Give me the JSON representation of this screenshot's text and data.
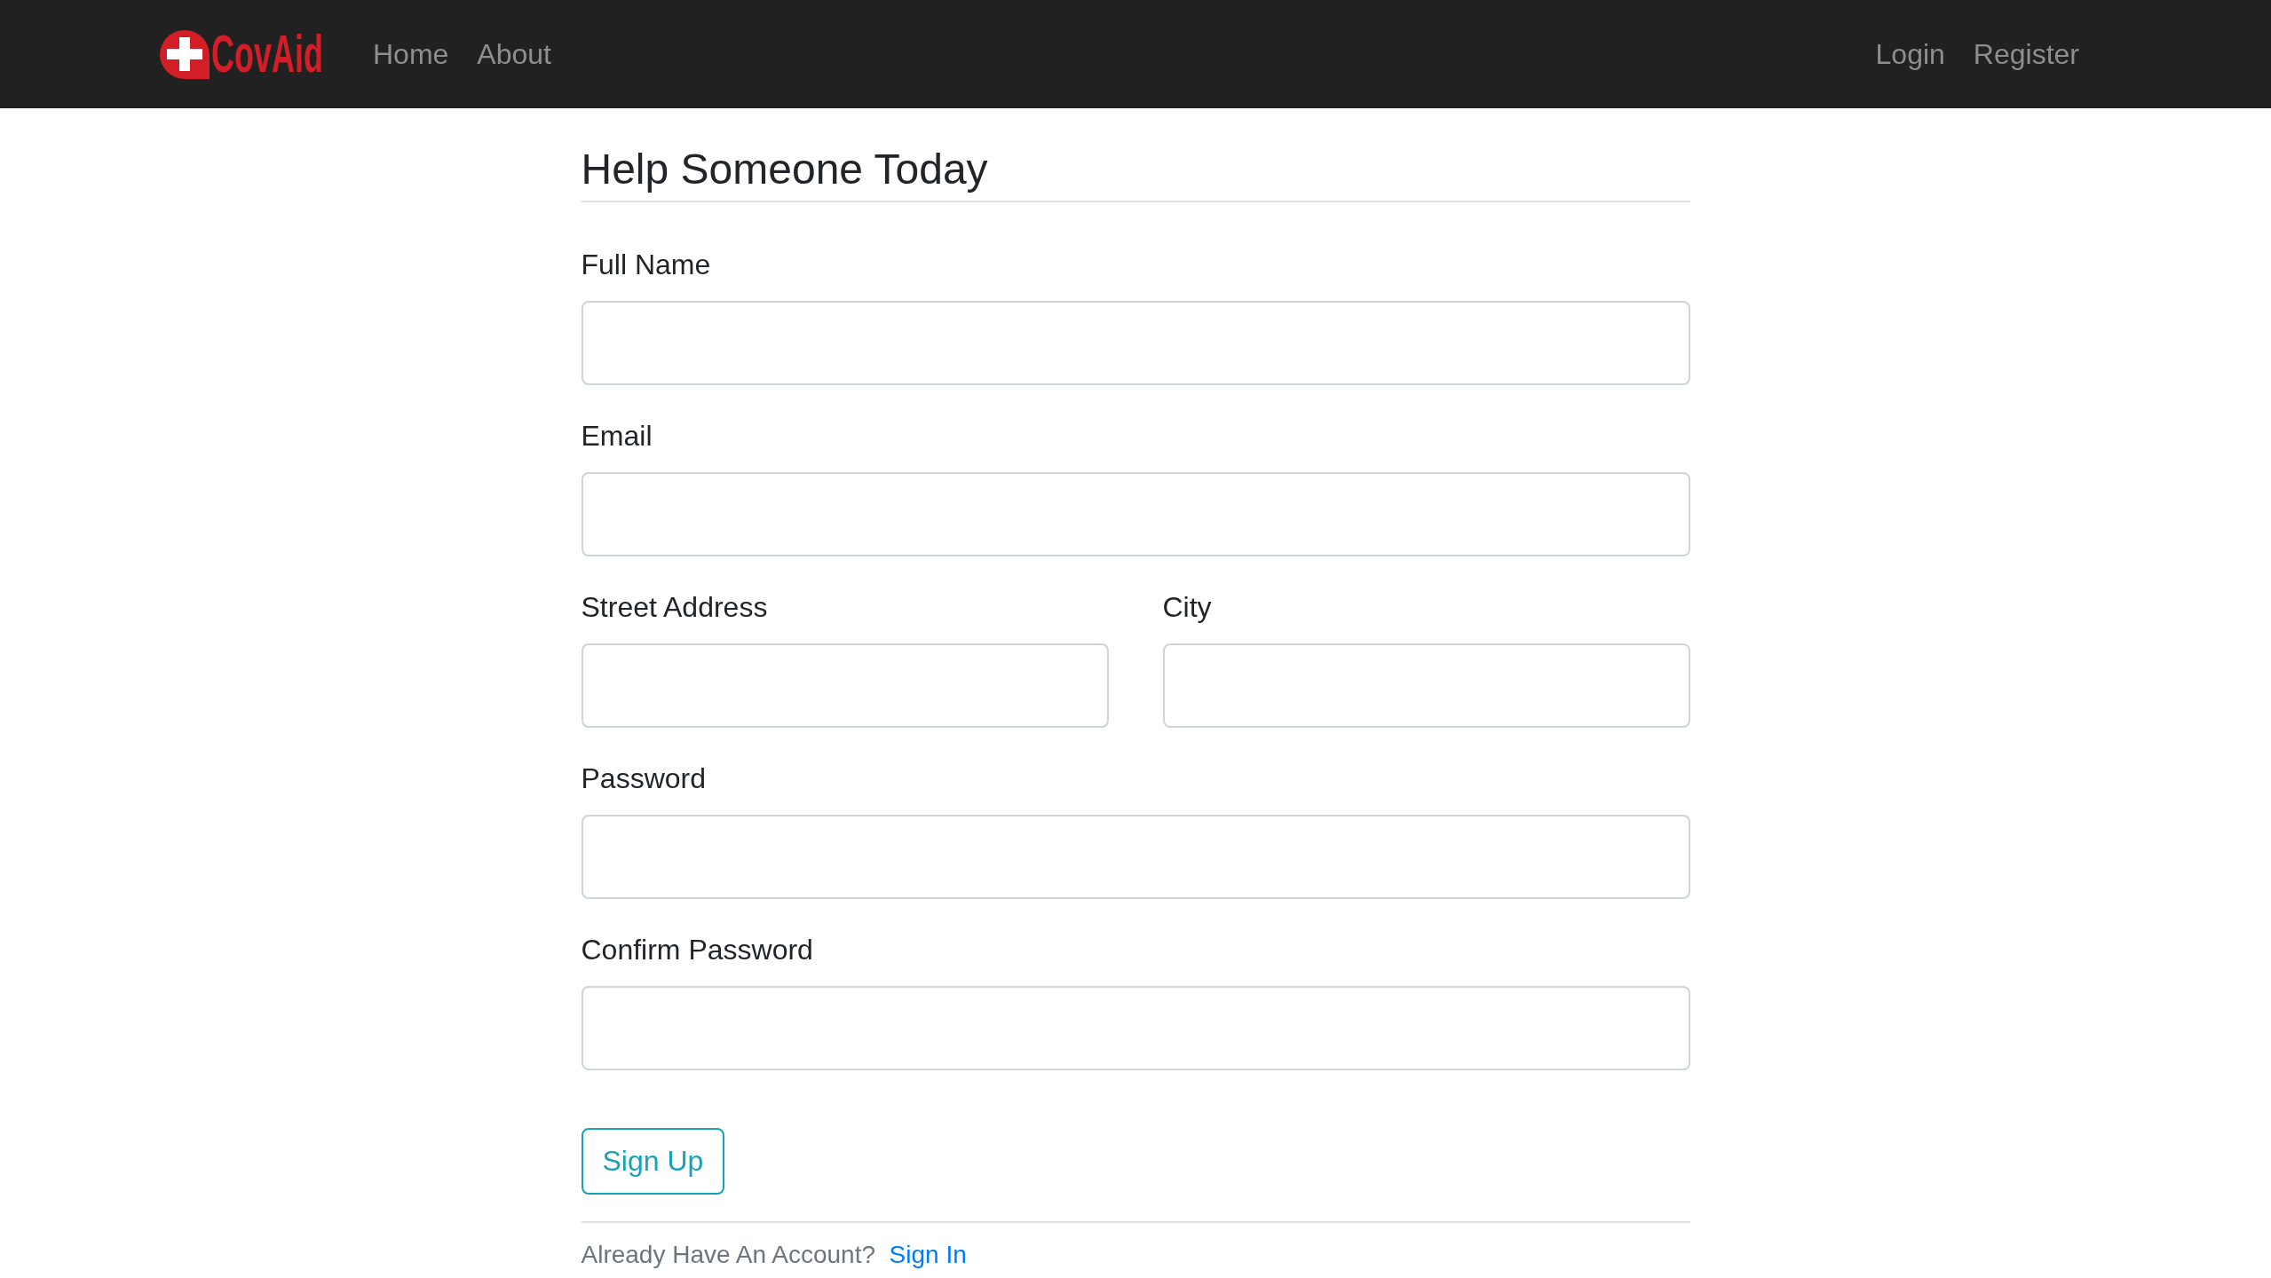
{
  "navbar": {
    "brand": "CovAid",
    "links": [
      {
        "label": "Home"
      },
      {
        "label": "About"
      }
    ],
    "account_links": [
      {
        "label": "Login"
      },
      {
        "label": "Register"
      }
    ]
  },
  "form": {
    "title": "Help Someone Today",
    "rows": [
      {
        "fields": [
          {
            "label": "Full Name"
          }
        ]
      },
      {
        "fields": [
          {
            "label": "Email"
          }
        ]
      },
      {
        "fields": [
          {
            "label": "Street Address"
          },
          {
            "label": "City"
          }
        ]
      },
      {
        "fields": [
          {
            "label": "Password"
          }
        ]
      },
      {
        "fields": [
          {
            "label": "Confirm Password"
          }
        ]
      }
    ],
    "submit": "Sign Up"
  },
  "footer": {
    "text": "Already Have An Account?",
    "link": "Sign In"
  }
}
